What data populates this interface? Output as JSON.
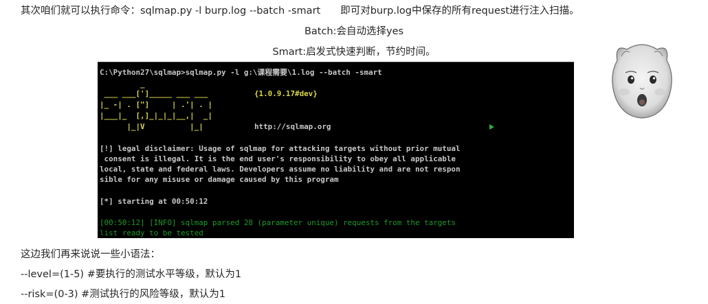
{
  "text": {
    "line1": "其次咱们就可以执行命令：sqlmap.py -l burp.log --batch -smart　　即可对burp.log中保存的所有request进行注入扫描。",
    "line2": "Batch:会自动选择yes",
    "line3": "Smart:启发式快速判断，节约时间。",
    "line4": "这边我们再来说说一些小语法：",
    "line5": "--level=(1-5) #要执行的测试水平等级，默认为1",
    "line6": "--risk=(0-3) #测试执行的风险等级，默认为1"
  },
  "terminal": {
    "command": "C:\\Python27\\sqlmap>sqlmap.py -l g:\\课程需要\\1.log --batch -smart",
    "logo_row1": "         _",
    "logo_row2": " ___ ___[']_____ ___ ___ ",
    "logo_row3": "|_ -| . [\"]     | .'| . |",
    "logo_row4": "|___|_  [,]_|_|_|__,|  _|",
    "logo_row5": "      |_|V          |_|",
    "version": "{1.0.9.17#dev}",
    "url": "http://sqlmap.org",
    "disclaimer1": "[!] legal disclaimer: Usage of sqlmap for attacking targets without prior mutual",
    "disclaimer2": " consent is illegal. It is the end user's responsibility to obey all applicable",
    "disclaimer3": "local, state and federal laws. Developers assume no liability and are not respon",
    "disclaimer4": "sible for any misuse or damage caused by this program",
    "starting": "[*] starting at 00:50:12",
    "info1": "[00:50:12] [INFO] sqlmap parsed 28 (parameter unique) requests from the targets",
    "info2": "list ready to be tested"
  },
  "colors": {
    "terminal_bg": "#000000",
    "terminal_text": "#c8c8c8",
    "logo_yellow": "#d9d64a",
    "info_green": "#1f9a2a"
  },
  "icons": {
    "meme": "baby-face-meme-icon",
    "cursor": "mouse-cursor-icon"
  }
}
